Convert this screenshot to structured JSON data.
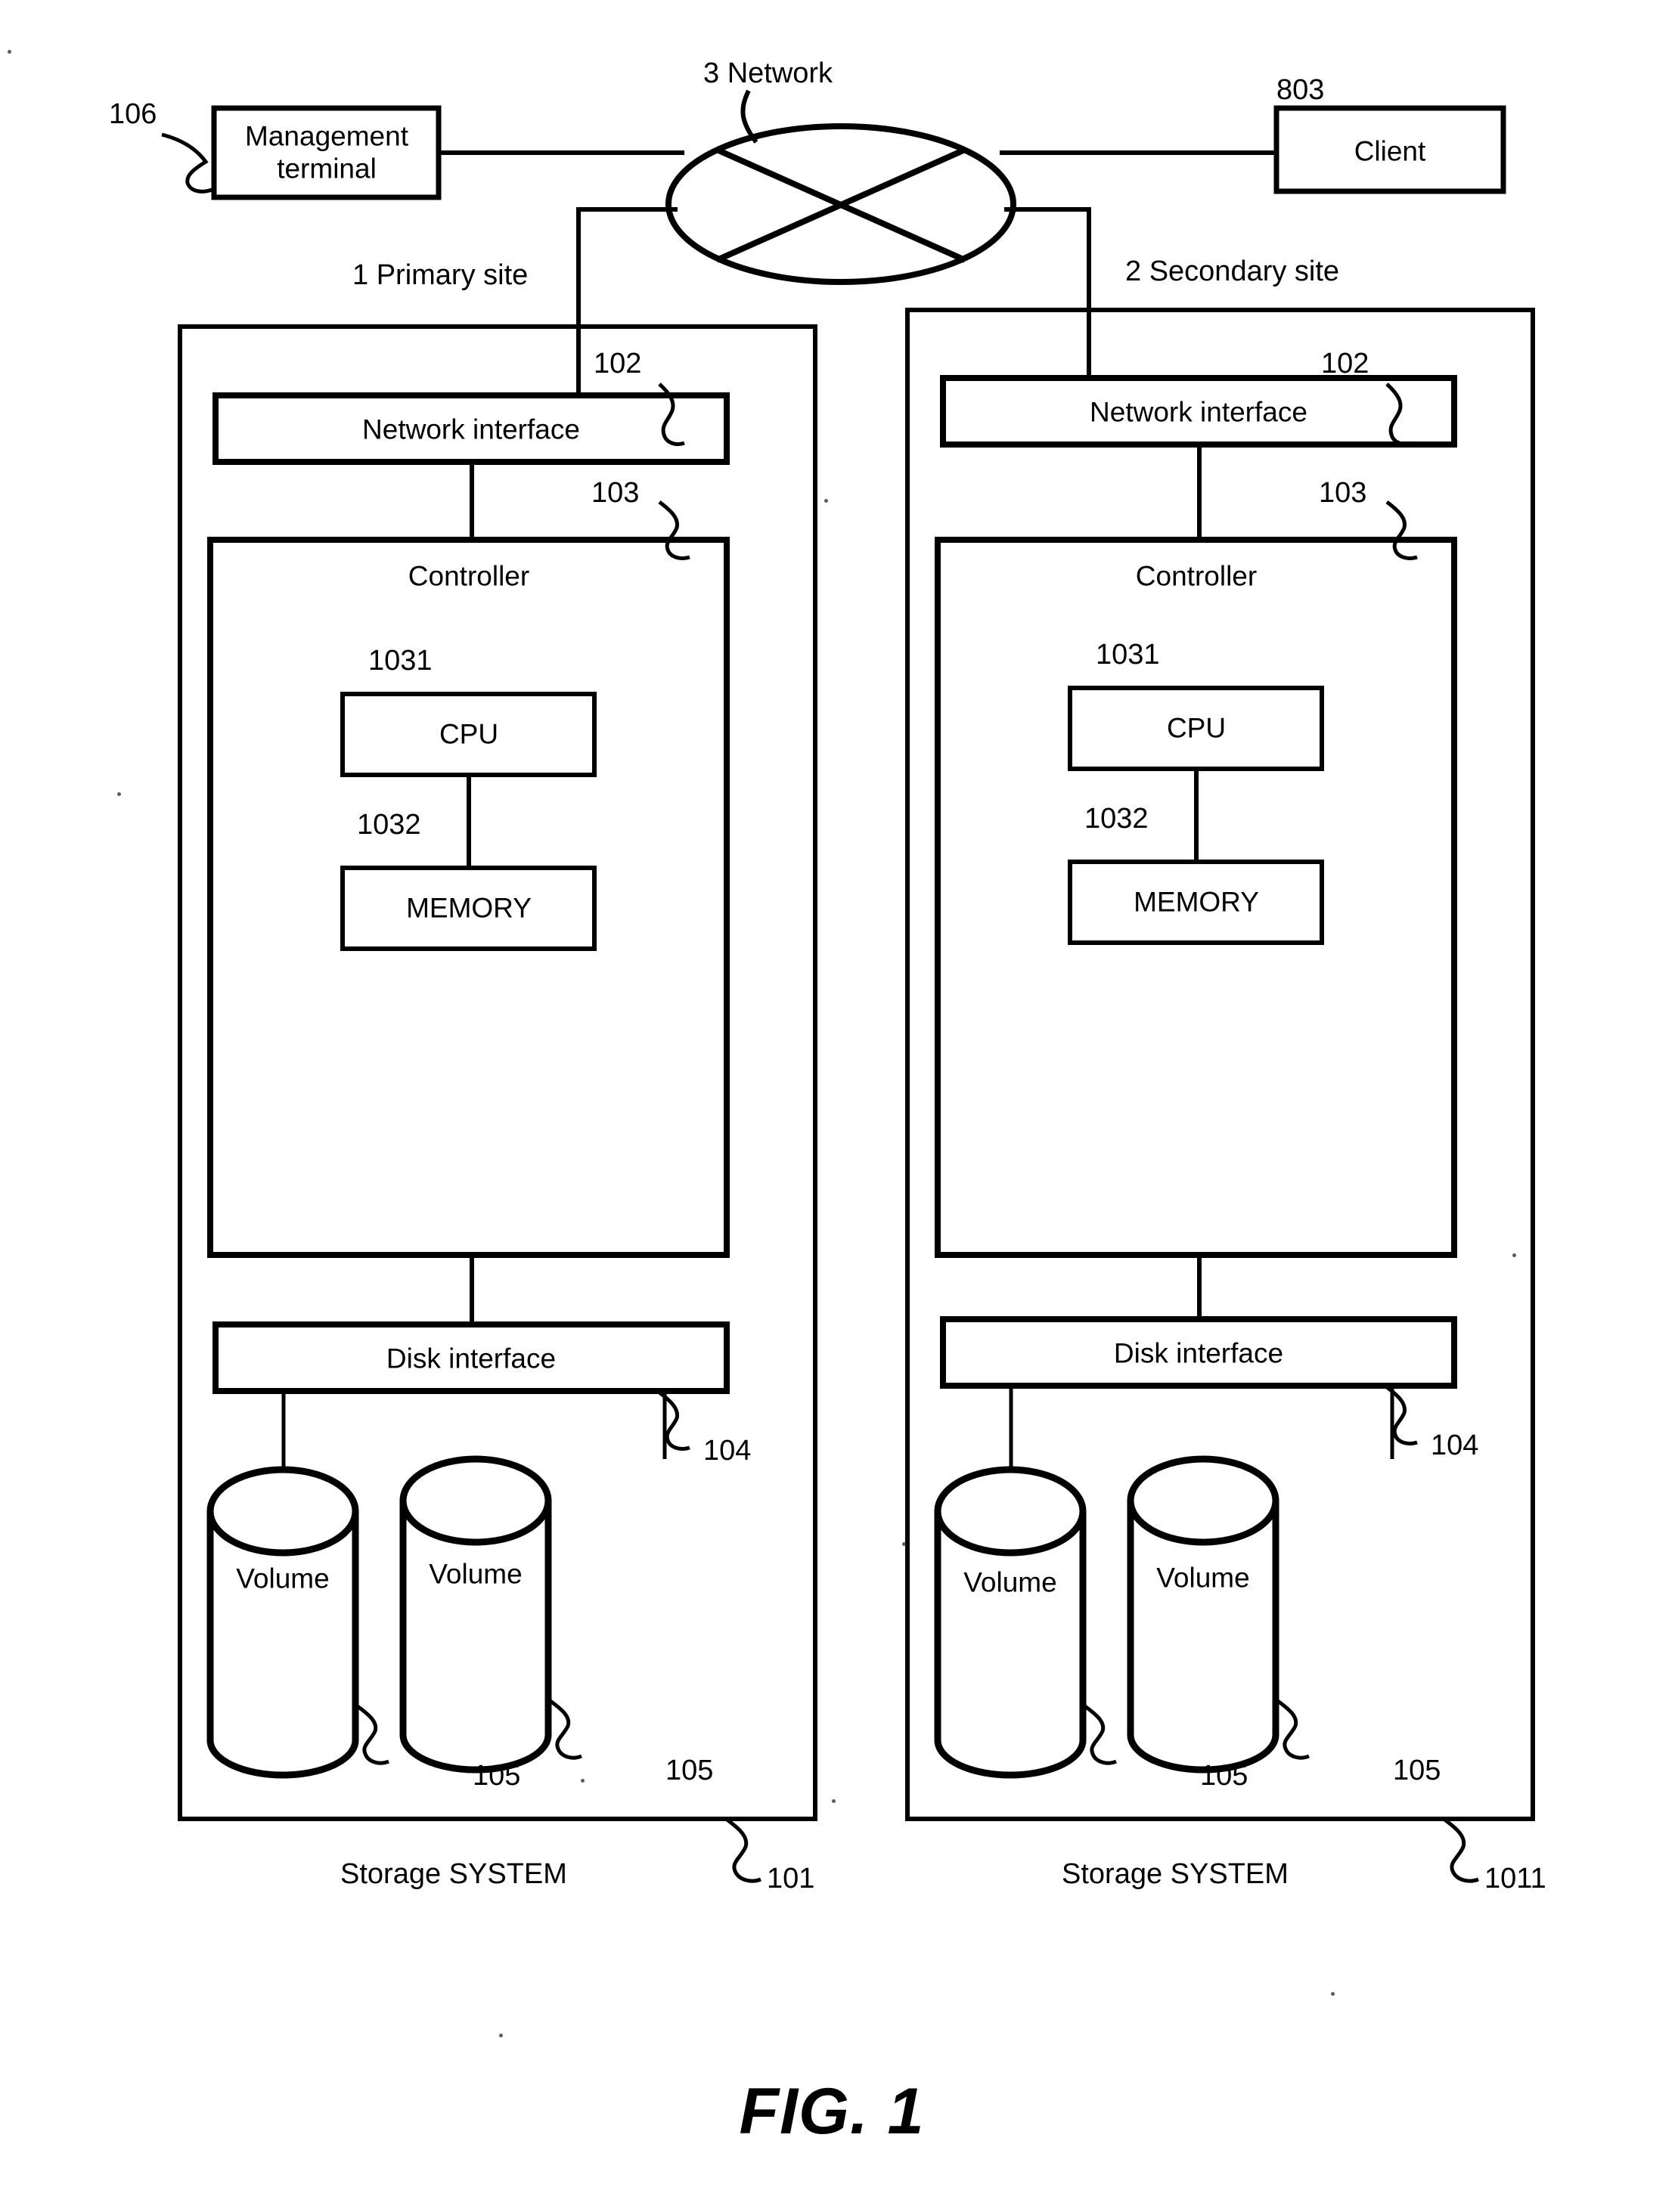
{
  "figure": {
    "caption": "FIG. 1"
  },
  "top": {
    "management_terminal": {
      "ref": "106",
      "label_line1": "Management",
      "label_line2": "terminal"
    },
    "network": {
      "label": "3 Network"
    },
    "client": {
      "ref": "803",
      "label": "Client"
    }
  },
  "sites": [
    {
      "id": "primary",
      "site_label": "1  Primary site",
      "system_label": "Storage SYSTEM",
      "system_ref": "101",
      "network_interface": {
        "label": "Network interface",
        "ref": "102"
      },
      "controller": {
        "label": "Controller",
        "ref": "103"
      },
      "cpu": {
        "label": "CPU",
        "ref": "1031"
      },
      "memory": {
        "label": "MEMORY",
        "ref": "1032"
      },
      "disk_interface": {
        "label": "Disk interface",
        "ref": "104"
      },
      "volumes": [
        {
          "label": "Volume",
          "ref": "105"
        },
        {
          "label": "Volume",
          "ref": "105"
        }
      ]
    },
    {
      "id": "secondary",
      "site_label": "2  Secondary site",
      "system_label": "Storage SYSTEM",
      "system_ref": "1011",
      "network_interface": {
        "label": "Network interface",
        "ref": "102"
      },
      "controller": {
        "label": "Controller",
        "ref": "103"
      },
      "cpu": {
        "label": "CPU",
        "ref": "1031"
      },
      "memory": {
        "label": "MEMORY",
        "ref": "1032"
      },
      "disk_interface": {
        "label": "Disk interface",
        "ref": "104"
      },
      "volumes": [
        {
          "label": "Volume",
          "ref": "105"
        },
        {
          "label": "Volume",
          "ref": "105"
        }
      ]
    }
  ],
  "style": {
    "ink": "#000000",
    "paper": "#ffffff"
  }
}
